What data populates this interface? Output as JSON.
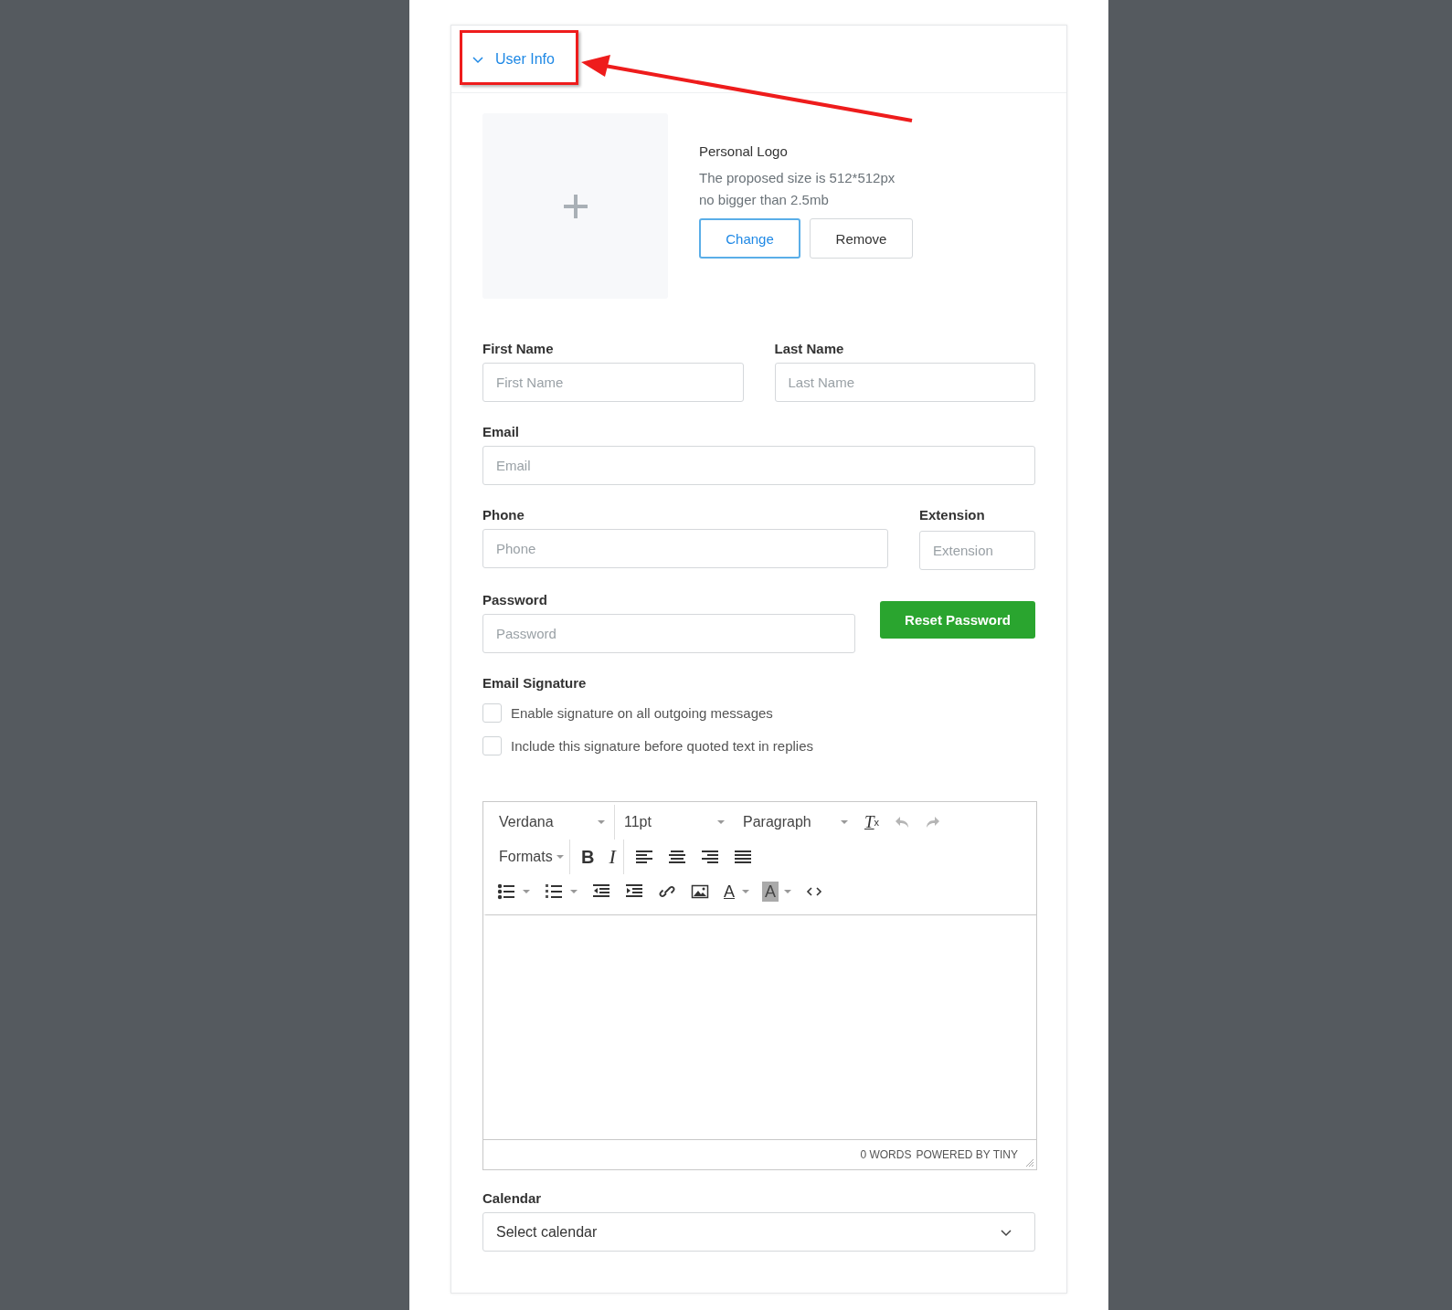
{
  "section": {
    "title": "User Info",
    "expanded": true
  },
  "logo": {
    "label": "Personal Logo",
    "hint_lines": [
      "The proposed size is 512*512px",
      "no bigger than 2.5mb"
    ],
    "buttons": [
      {
        "label": "Change",
        "kind": "primary"
      },
      {
        "label": "Remove",
        "kind": "default"
      }
    ]
  },
  "fields": {
    "first_name": {
      "label": "First Name",
      "placeholder": "First Name"
    },
    "last_name": {
      "label": "Last Name",
      "placeholder": "Last Name"
    },
    "email": {
      "label": "Email",
      "placeholder": "Email"
    },
    "phone": {
      "label": "Phone",
      "placeholder": "Phone"
    },
    "extension": {
      "label": "Extension",
      "placeholder": "Extension"
    },
    "password": {
      "label": "Password",
      "placeholder": "Password"
    }
  },
  "reset_button": "Reset Password",
  "signature": {
    "label": "Email Signature",
    "options": [
      {
        "label": "Enable signature on all outgoing messages",
        "checked": false
      },
      {
        "label": "Include this signature before quoted text in replies",
        "checked": false
      }
    ]
  },
  "editor": {
    "font": "Verdana",
    "size": "11pt",
    "block": "Paragraph",
    "formats": "Formats",
    "glyphs": {
      "clear": "T",
      "clear_sub": "x",
      "bold": "B",
      "italic": "I",
      "text_color": "A",
      "background_color": "A"
    },
    "undo_disabled": true,
    "redo_disabled": true,
    "word_count": "0 WORDS",
    "branding": "POWERED BY TINY"
  },
  "calendar": {
    "label": "Calendar",
    "value": "Select calendar"
  }
}
